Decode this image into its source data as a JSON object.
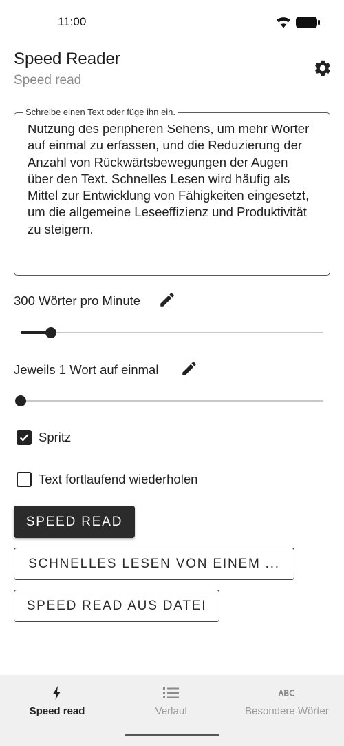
{
  "status_bar": {
    "time": "11:00"
  },
  "header": {
    "title": "Speed Reader",
    "subtitle": "Speed read"
  },
  "text_input": {
    "label": "Schreibe einen Text oder füge ihn ein.",
    "value": "Nutzung des peripheren Sehens, um mehr Wörter auf einmal zu erfassen, und die Reduzierung der Anzahl von Rückwärtsbewegungen der Augen über den Text. Schnelles Lesen wird häufig als Mittel zur Entwicklung von Fähigkeiten eingesetzt, um die allgemeine Leseeffizienz und Produktivität zu steigern."
  },
  "speed": {
    "label": "300 Wörter pro Minute",
    "slider_fraction": 0.1
  },
  "words": {
    "label": "Jeweils 1 Wort auf einmal",
    "slider_fraction": 0.0
  },
  "options": {
    "spritz": {
      "label": "Spritz",
      "checked": true
    },
    "repeat": {
      "label": "Text fortlaufend wiederholen",
      "checked": false
    }
  },
  "buttons": {
    "speed_read": "SPEED READ",
    "from_url": "SCHNELLES LESEN VON EINEM ...",
    "from_file": "SPEED READ AUS DATEI"
  },
  "bottom_nav": [
    {
      "label": "Speed read",
      "icon": "bolt-icon",
      "active": true
    },
    {
      "label": "Verlauf",
      "icon": "list-icon",
      "active": false
    },
    {
      "label": "Besondere Wörter",
      "icon": "abc-icon",
      "active": false
    }
  ],
  "colors": {
    "accent": "#2b2b2b",
    "nav_background": "#f0f0f0",
    "inactive": "#9a9a9a"
  }
}
